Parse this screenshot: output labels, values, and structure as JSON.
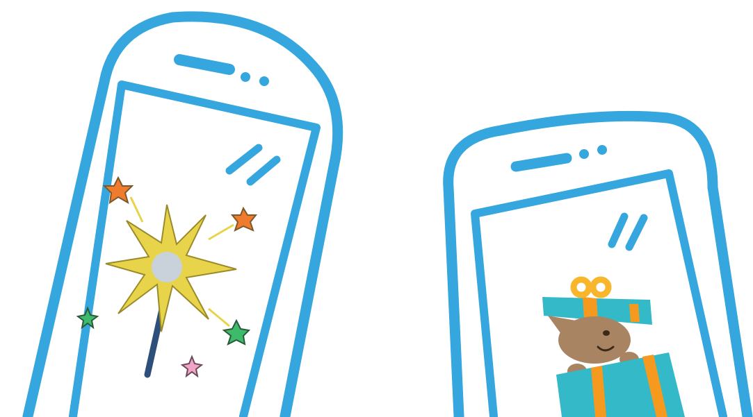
{
  "illustration": {
    "colors": {
      "phone_outline": "#35a7de",
      "background": "#ffffff",
      "sparkle_gold": "#e8d44a",
      "sparkle_silver": "#c9d2da",
      "wand": "#2e4f7a",
      "star_orange": "#f07a2e",
      "star_green": "#3dbb6b",
      "star_pink": "#f2a3c8",
      "gift_teal": "#33b9c8",
      "gift_ribbon": "#f59a1f",
      "gift_bow": "#f7b62b",
      "animal_fur": "#a98462"
    },
    "phones": [
      {
        "name": "phone-left",
        "screen_icon": "sparkler-wand-icon"
      },
      {
        "name": "phone-right",
        "screen_icon": "gift-box-animal-icon"
      }
    ]
  }
}
